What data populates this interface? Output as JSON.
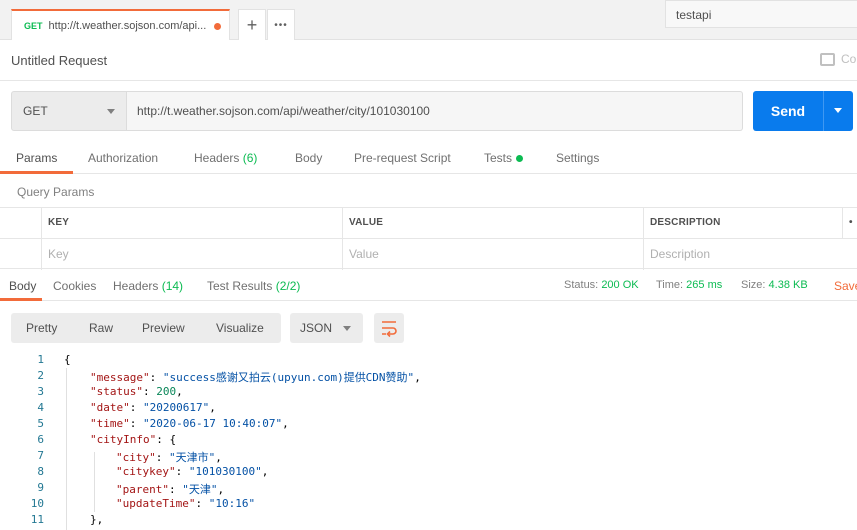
{
  "tabstrip": {
    "tab": {
      "method": "GET",
      "url": "http://t.weather.sojson.com/api..."
    },
    "new_tab": "+",
    "more": "•••",
    "environment": "testapi"
  },
  "request": {
    "title": "Untitled Request",
    "comments_label": "Co",
    "method": "GET",
    "url": "http://t.weather.sojson.com/api/weather/city/101030100",
    "send_label": "Send"
  },
  "request_tabs": [
    {
      "label": "Params",
      "badge": ""
    },
    {
      "label": "Authorization",
      "badge": ""
    },
    {
      "label": "Headers",
      "badge": "(6)"
    },
    {
      "label": "Body",
      "badge": ""
    },
    {
      "label": "Pre-request Script",
      "badge": ""
    },
    {
      "label": "Tests",
      "badge": ""
    },
    {
      "label": "Settings",
      "badge": ""
    }
  ],
  "query_params": {
    "label": "Query Params",
    "headers": [
      "KEY",
      "VALUE",
      "DESCRIPTION"
    ],
    "more": "•",
    "placeholders": [
      "Key",
      "Value",
      "Description"
    ]
  },
  "response_tabs": [
    {
      "label": "Body",
      "badge": ""
    },
    {
      "label": "Cookies",
      "badge": ""
    },
    {
      "label": "Headers",
      "badge": "(14)"
    },
    {
      "label": "Test Results",
      "badge": "(2/2)"
    }
  ],
  "response_meta": {
    "status_label": "Status:",
    "status": "200 OK",
    "time_label": "Time:",
    "time": "265 ms",
    "size_label": "Size:",
    "size": "4.38 KB",
    "save_label": "Save"
  },
  "response_toolbar": {
    "views": [
      "Pretty",
      "Raw",
      "Preview",
      "Visualize"
    ],
    "format": "JSON"
  },
  "code_lines": [
    {
      "n": "1",
      "text": "{"
    },
    {
      "n": "2",
      "key": "\"message\"",
      "value": "\"success感谢又拍云(upyun.com)提供CDN赞助\"",
      "type": "s",
      "indent": 1
    },
    {
      "n": "3",
      "key": "\"status\"",
      "value": "200",
      "type": "n",
      "indent": 1
    },
    {
      "n": "4",
      "key": "\"date\"",
      "value": "\"20200617\"",
      "type": "s",
      "indent": 1
    },
    {
      "n": "5",
      "key": "\"time\"",
      "value": "\"2020-06-17 10:40:07\"",
      "type": "s",
      "indent": 1
    },
    {
      "n": "6",
      "key": "\"cityInfo\"",
      "value": "{",
      "type": "p",
      "indent": 1
    },
    {
      "n": "7",
      "key": "\"city\"",
      "value": "\"天津市\"",
      "type": "s",
      "indent": 2
    },
    {
      "n": "8",
      "key": "\"citykey\"",
      "value": "\"101030100\"",
      "type": "s",
      "indent": 2
    },
    {
      "n": "9",
      "key": "\"parent\"",
      "value": "\"天津\"",
      "type": "s",
      "indent": 2
    },
    {
      "n": "10",
      "key": "\"updateTime\"",
      "value": "\"10:16\"",
      "type": "s",
      "indent": 2,
      "last": true
    },
    {
      "n": "11",
      "text": "},",
      "indent": 1
    }
  ],
  "colors": {
    "accent": "#f26b3a",
    "send": "#097bed",
    "success": "#0cbb52"
  }
}
